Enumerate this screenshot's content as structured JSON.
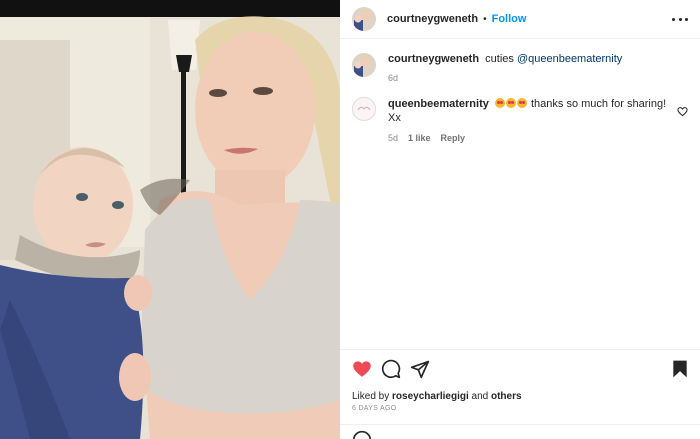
{
  "post": {
    "username": "courtneygweneth",
    "follow_label": "Follow",
    "dot": "•"
  },
  "caption": {
    "username": "courtneygweneth",
    "text": "cuties",
    "mention": "@queenbeematernity",
    "time": "6d"
  },
  "comment": {
    "username": "queenbeematernity",
    "text": "thanks so much for sharing! Xx",
    "time": "5d",
    "likes": "1 like",
    "reply_label": "Reply"
  },
  "actions": {
    "liked_prefix": "Liked by",
    "liked_user": "roseycharliegigi",
    "liked_and": "and",
    "liked_others": "others",
    "time_ago": "6 DAYS AGO"
  },
  "colors": {
    "accent": "#0095f6",
    "heart": "#ed4956",
    "mention": "#00376b",
    "muted": "#8e8e8e"
  },
  "icons": {
    "more": "more-options-icon",
    "heart": "heart-filled-icon",
    "comment": "comment-icon",
    "share": "share-icon",
    "save": "bookmark-icon"
  }
}
